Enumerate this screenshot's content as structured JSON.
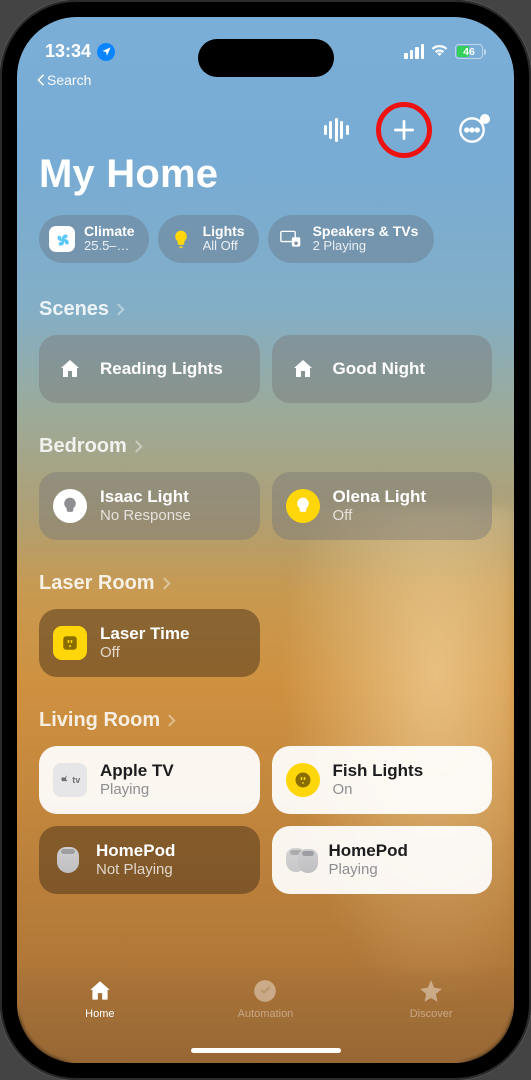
{
  "status": {
    "time": "13:34",
    "battery": "46"
  },
  "back": "Search",
  "title": "My Home",
  "summary": {
    "climate": {
      "label": "Climate",
      "sub": "25.5–…"
    },
    "lights": {
      "label": "Lights",
      "sub": "All Off"
    },
    "speakers": {
      "label": "Speakers & TVs",
      "sub": "2 Playing"
    }
  },
  "sections": {
    "scenes": {
      "title": "Scenes",
      "items": [
        {
          "title": "Reading Lights"
        },
        {
          "title": "Good Night"
        }
      ]
    },
    "bedroom": {
      "title": "Bedroom",
      "items": [
        {
          "title": "Isaac Light",
          "sub": "No Response"
        },
        {
          "title": "Olena Light",
          "sub": "Off"
        }
      ]
    },
    "laser": {
      "title": "Laser Room",
      "items": [
        {
          "title": "Laser Time",
          "sub": "Off"
        }
      ]
    },
    "living": {
      "title": "Living Room",
      "items": [
        {
          "title": "Apple TV",
          "sub": "Playing"
        },
        {
          "title": "Fish Lights",
          "sub": "On"
        },
        {
          "title": "HomePod",
          "sub": "Not Playing"
        },
        {
          "title": "HomePod",
          "sub": "Playing"
        }
      ]
    }
  },
  "tabs": {
    "home": "Home",
    "automation": "Automation",
    "discover": "Discover"
  }
}
